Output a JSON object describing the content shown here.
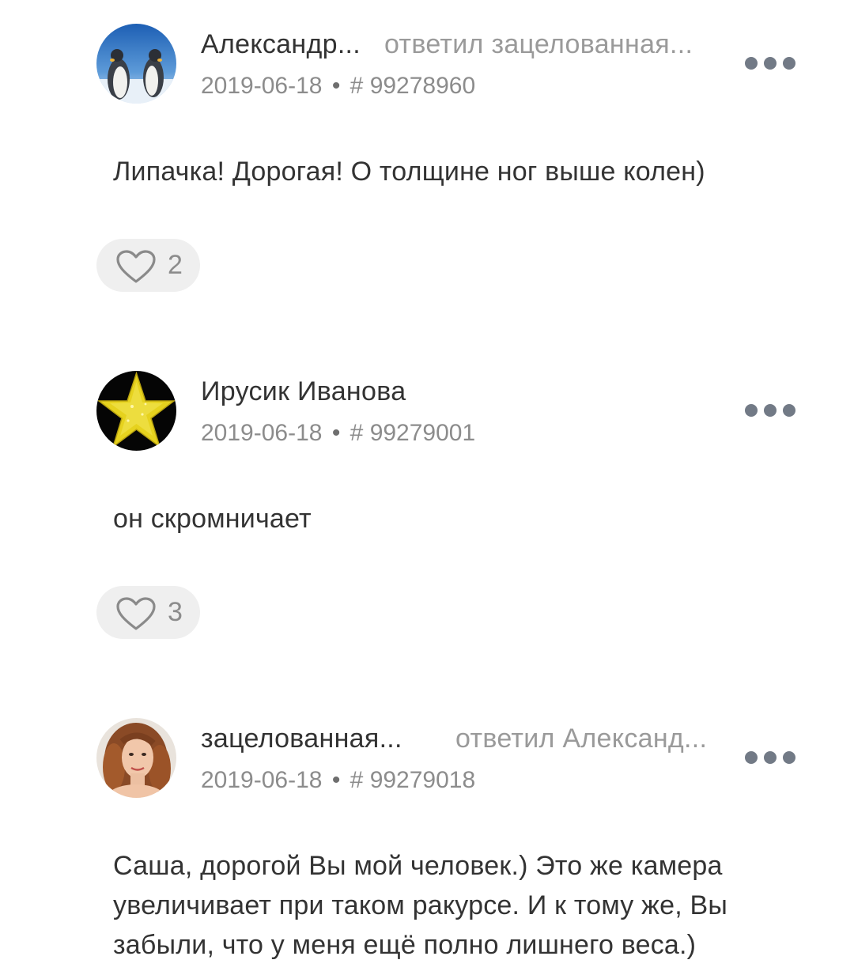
{
  "comments": [
    {
      "author": "Александр...",
      "reply_text": "ответил зацелованная...",
      "date": "2019-06-18",
      "separator": "•",
      "number": "# 99278960",
      "text": "Липачка! Дорогая! О толщине ног выше колен)",
      "likes": "2",
      "avatar": "penguins-avatar"
    },
    {
      "author": "Ирусик Иванова",
      "reply_text": "",
      "date": "2019-06-18",
      "separator": "•",
      "number": "# 99279001",
      "text": "он скромничает",
      "likes": "3",
      "avatar": "gold-star-avatar"
    },
    {
      "author": "зацелованная...",
      "reply_text": "ответил Александ...",
      "date": "2019-06-18",
      "separator": "•",
      "number": "# 99279018",
      "text": "Саша, дорогой Вы мой человек.) Это же камера увеличивает при таком ракурсе. И к тому же, Вы забыли, что у меня ещё полно лишнего веса.)",
      "avatar": "woman-portrait-avatar"
    }
  ],
  "icons": {
    "like": "heart-outline-icon",
    "more": "more-dots-icon"
  },
  "colors": {
    "text": "#333333",
    "muted": "#8c8c8c",
    "like_bg": "#efefef",
    "dots": "#727a86",
    "star": "#e6d21e"
  }
}
